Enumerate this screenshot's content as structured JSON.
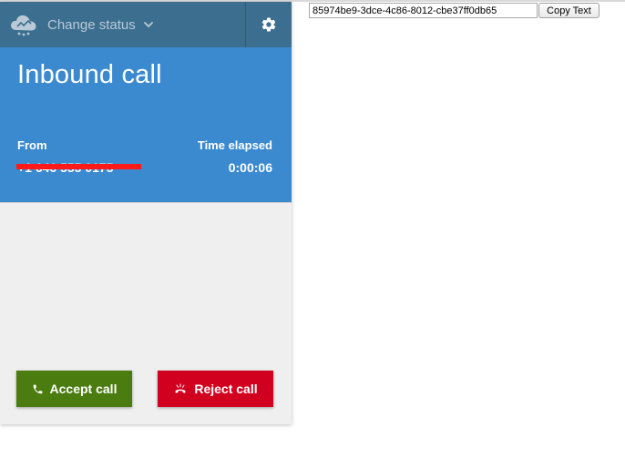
{
  "header": {
    "status_label": "Change status"
  },
  "call": {
    "title": "Inbound call",
    "from_label": "From",
    "from_value": "+1 646 555 0175",
    "elapsed_label": "Time elapsed",
    "elapsed_value": "0:00:06"
  },
  "actions": {
    "accept_label": "Accept call",
    "reject_label": "Reject call"
  },
  "utility": {
    "uuid_value": "85974be9-3dce-4c86-8012-cbe37ff0db65",
    "copy_label": "Copy Text"
  },
  "colors": {
    "header_bg": "#3c6e8f",
    "call_bg": "#3b8ad0",
    "accept_bg": "#4a7c0f",
    "reject_bg": "#d1001f",
    "redaction": "#ff1a1a"
  },
  "icons": {
    "logo": "cloud-logo-icon",
    "status": "chevron-down-icon",
    "settings": "gear-icon",
    "accept": "phone-icon",
    "reject": "hang-up-icon"
  }
}
